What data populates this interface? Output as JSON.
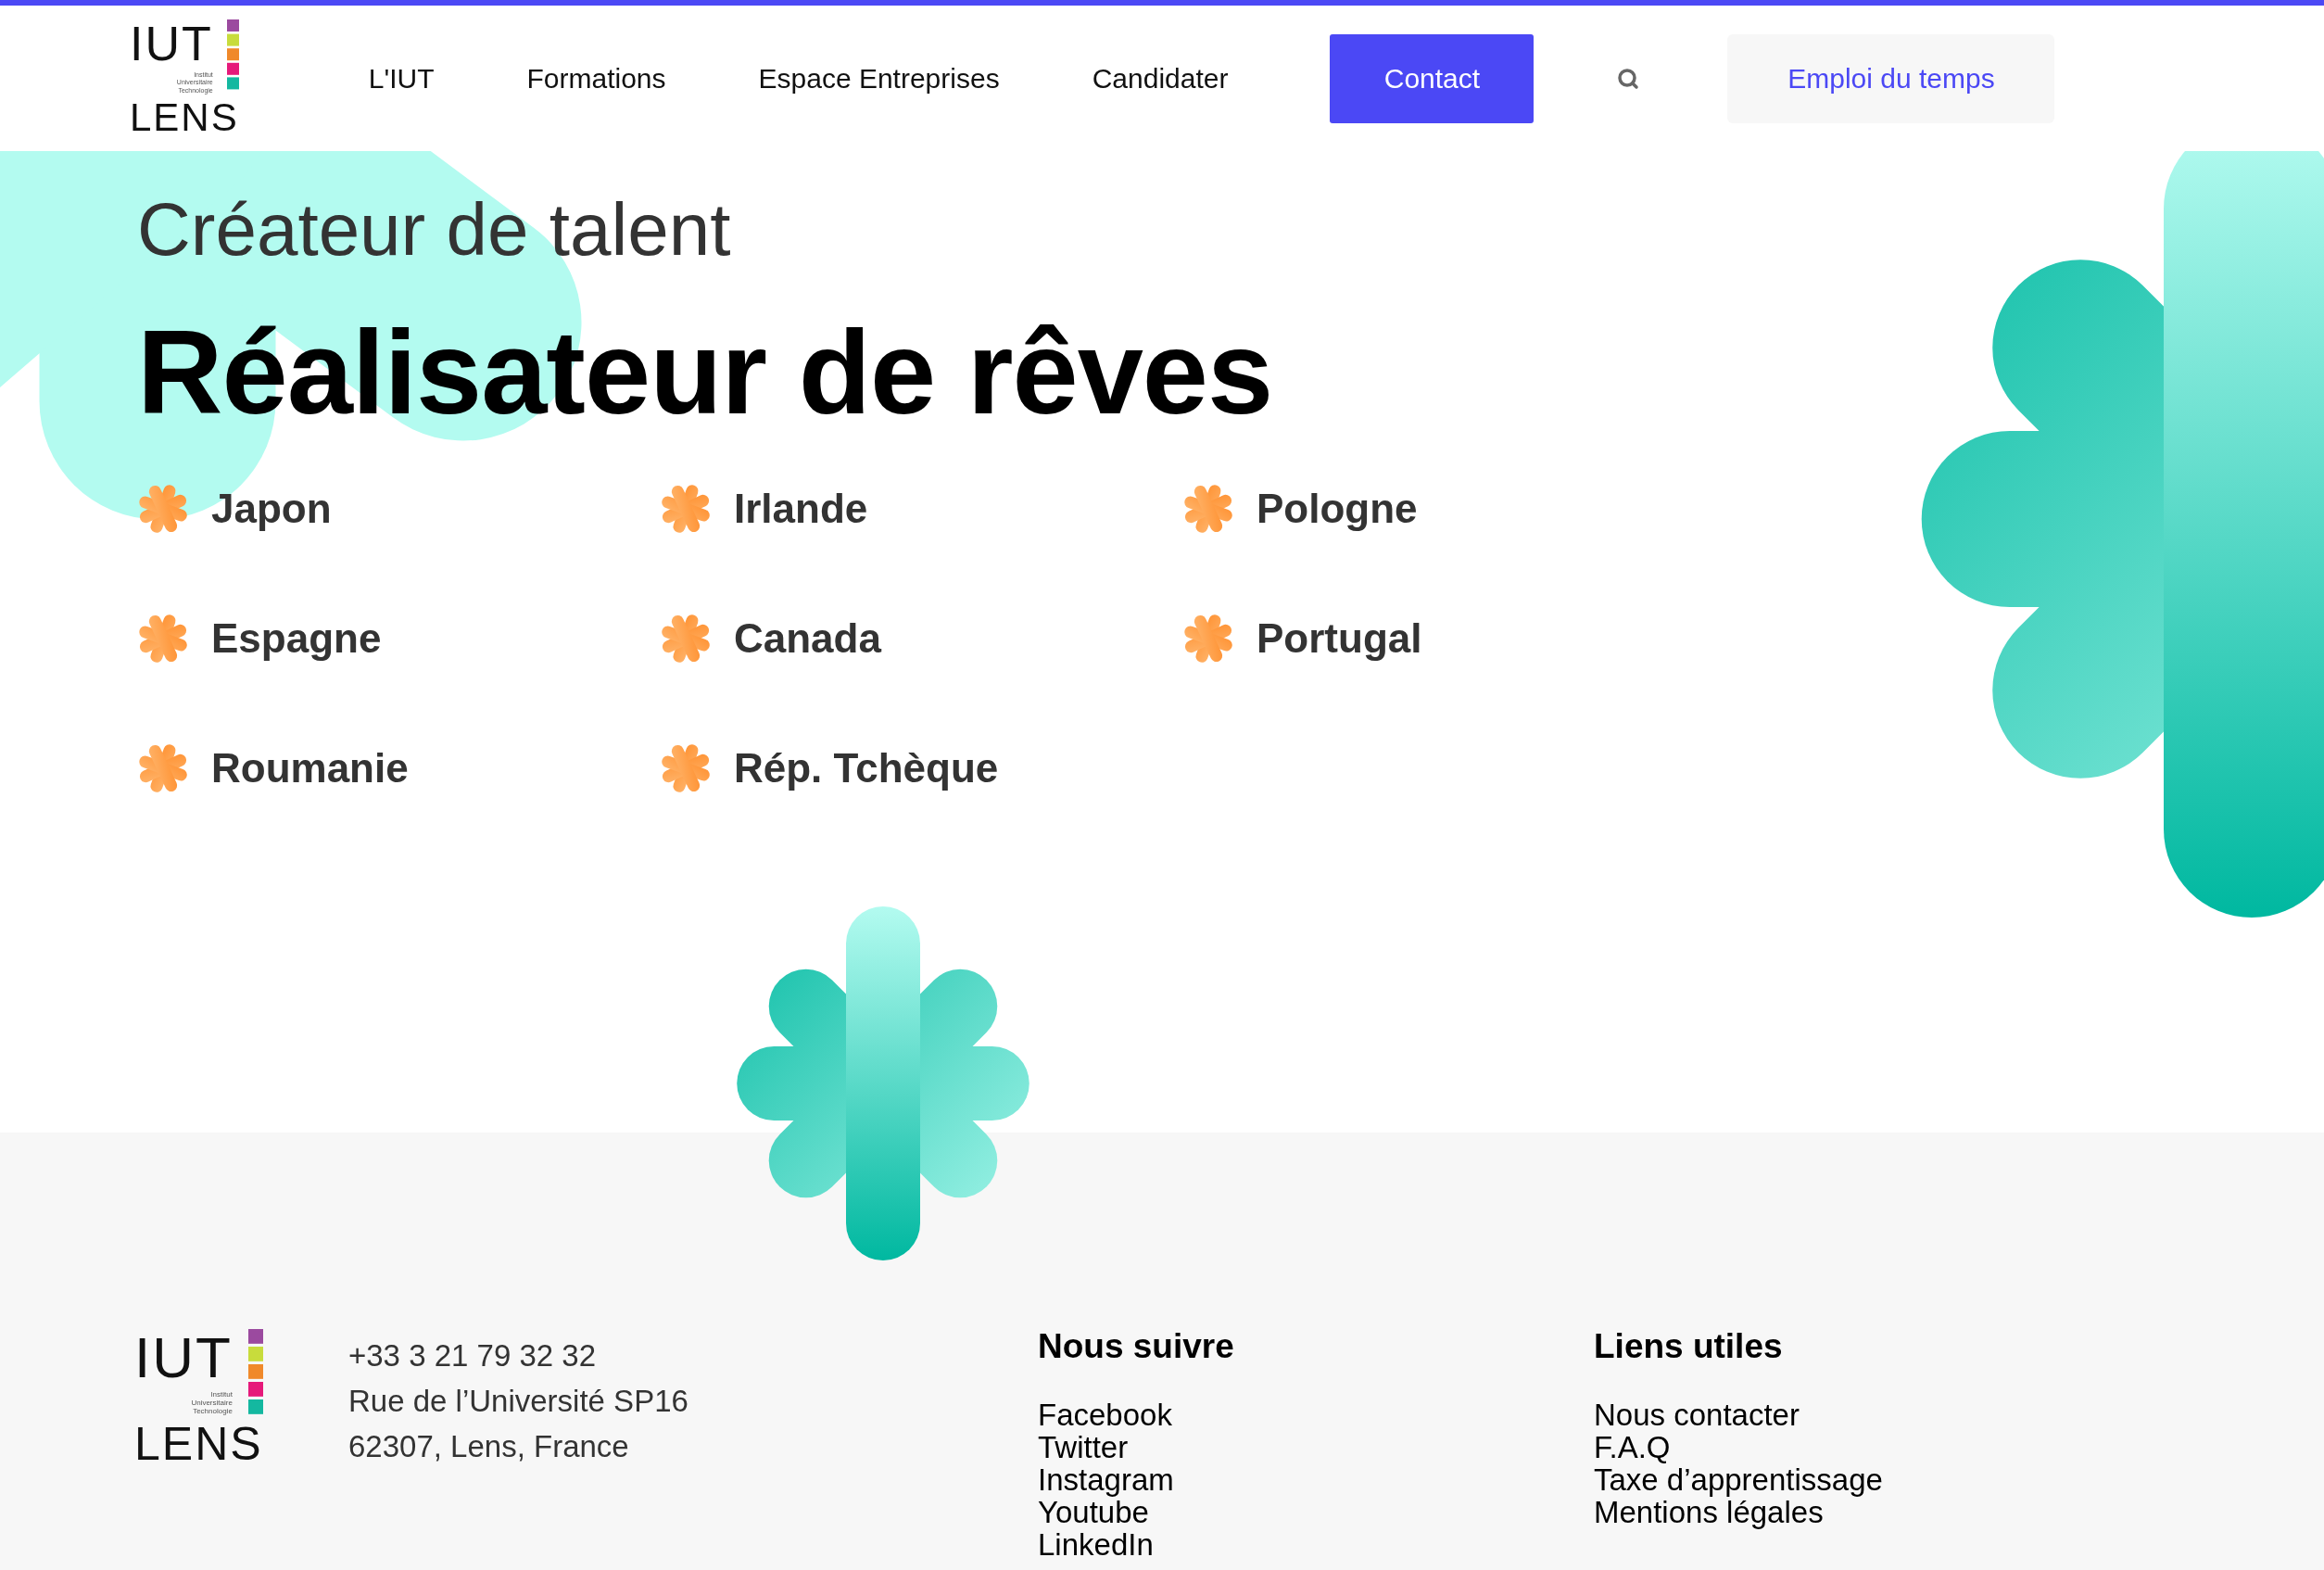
{
  "header": {
    "logo": {
      "main": "IUT",
      "sub": [
        "Institut",
        "Universitaire",
        "Technologie"
      ],
      "city": "LENS"
    },
    "nav": [
      "L'IUT",
      "Formations",
      "Espace Entreprises",
      "Candidater"
    ],
    "contact_button": "Contact",
    "schedule_button": "Emploi du temps"
  },
  "hero": {
    "subtitle": "Créateur de talent",
    "title": "Réalisateur de rêves"
  },
  "countries": [
    "Japon",
    "Irlande",
    "Pologne",
    "Espagne",
    "Canada",
    "Portugal",
    "Roumanie",
    "Rép. Tchèque"
  ],
  "footer": {
    "logo": {
      "main": "IUT",
      "sub": [
        "Institut",
        "Universitaire",
        "Technologie"
      ],
      "city": "LENS"
    },
    "contact": [
      "+33 3 21 79 32 32",
      "Rue de l’Université SP16",
      "62307, Lens, France"
    ],
    "columns": [
      {
        "title": "Nous suivre",
        "links": [
          "Facebook",
          "Twitter",
          "Instagram",
          "Youtube",
          "LinkedIn"
        ]
      },
      {
        "title": "Liens utiles",
        "links": [
          "Nous contacter",
          "F.A.Q",
          "Taxe d’apprentissage",
          "Mentions légales"
        ]
      }
    ]
  }
}
